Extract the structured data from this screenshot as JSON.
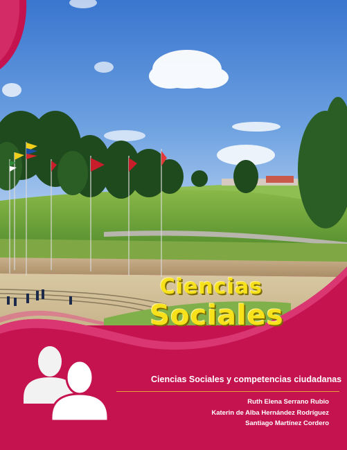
{
  "cover": {
    "title_line1": "Ciencias",
    "title_line2": "Sociales",
    "subtitle": "Ciencias Sociales y  competencias ciudadanas",
    "authors": [
      "Ruth Elena Serrano Rubio",
      "Katerin de Alba Hernández Rodríguez",
      "Santiago Martínez Cordero"
    ]
  },
  "colors": {
    "brand": "#c4134f",
    "title": "#f7e11a",
    "rule": "#e9a23a",
    "sky": "#4a86d6"
  },
  "icons": [
    "people-icon"
  ]
}
